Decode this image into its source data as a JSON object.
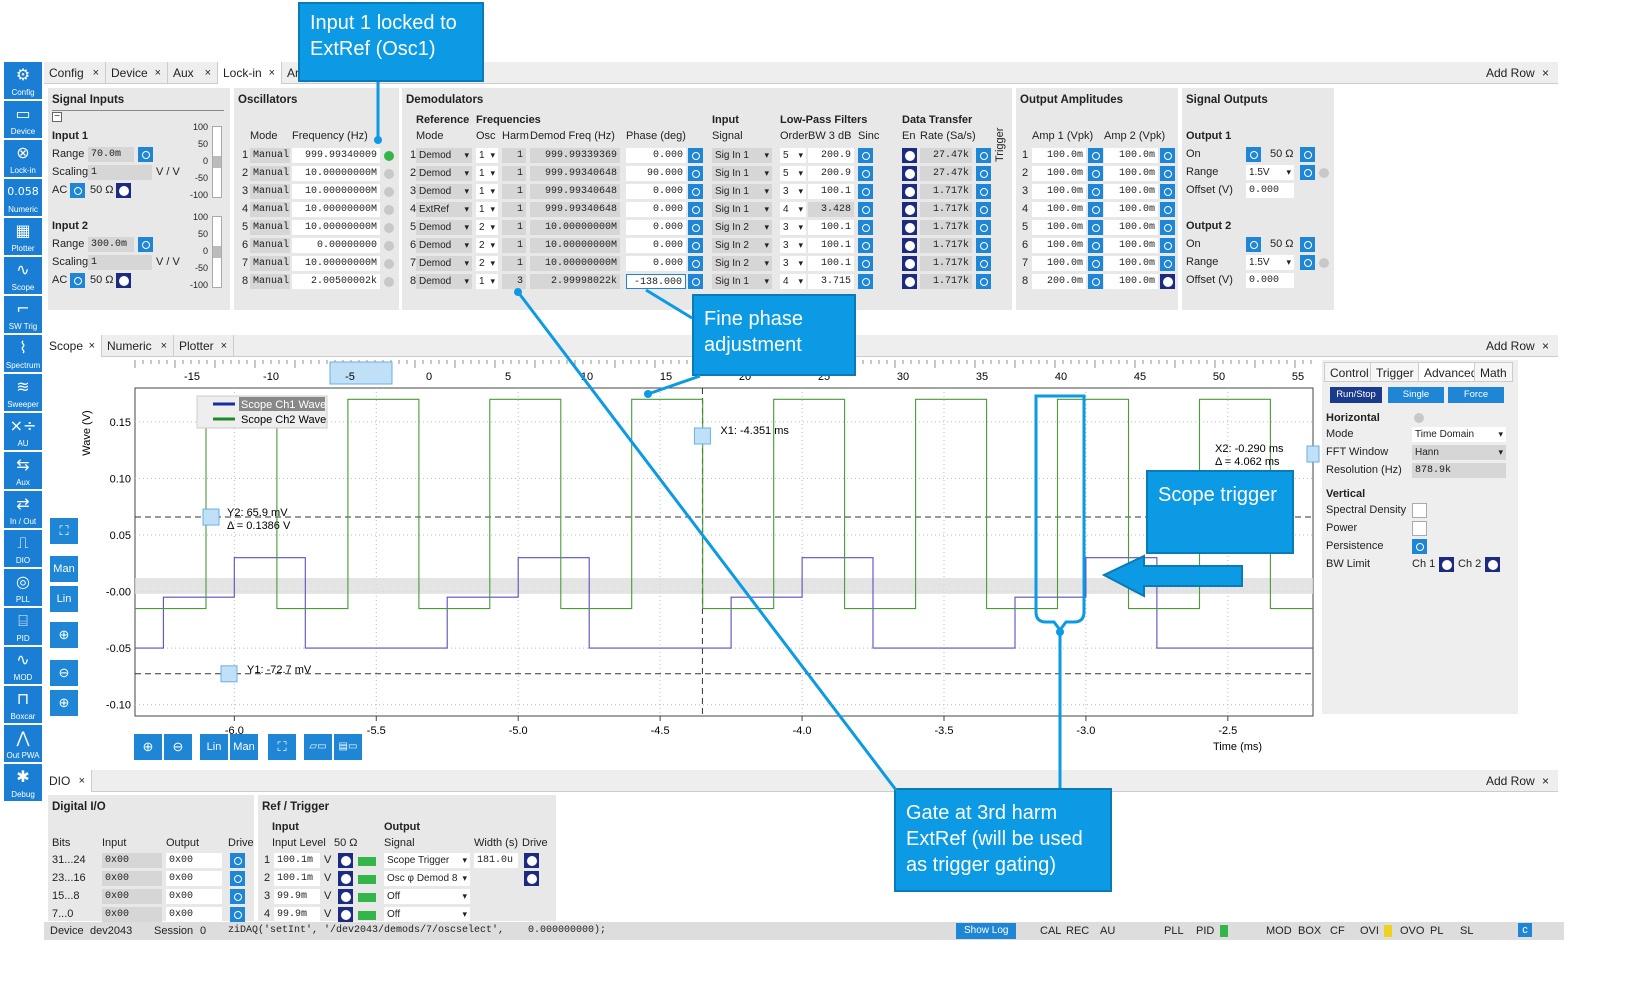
{
  "sidebar": [
    {
      "icon": "⚙",
      "label": "Config"
    },
    {
      "icon": "▭",
      "label": "Device"
    },
    {
      "icon": "⊗",
      "label": "Lock-in"
    },
    {
      "icon": "0.058",
      "label": "Numeric"
    },
    {
      "icon": "▦",
      "label": "Plotter"
    },
    {
      "icon": "∿",
      "label": "Scope"
    },
    {
      "icon": "⌐",
      "label": "SW Trig"
    },
    {
      "icon": "⌇",
      "label": "Spectrum"
    },
    {
      "icon": "≋",
      "label": "Sweeper"
    },
    {
      "icon": "×÷",
      "label": "AU"
    },
    {
      "icon": "⇆",
      "label": "Aux"
    },
    {
      "icon": "⇄",
      "label": "In / Out"
    },
    {
      "icon": "⎍",
      "label": "DIO"
    },
    {
      "icon": "◎",
      "label": "PLL"
    },
    {
      "icon": "⌸",
      "label": "PID"
    },
    {
      "icon": "∿",
      "label": "MOD"
    },
    {
      "icon": "⊓",
      "label": "Boxcar"
    },
    {
      "icon": "⋀",
      "label": "Out PWA"
    },
    {
      "icon": "✱",
      "label": "Debug"
    }
  ],
  "top_tabs": [
    {
      "label": "Config"
    },
    {
      "label": "Device"
    },
    {
      "label": "Aux"
    },
    {
      "label": "Lock-in"
    },
    {
      "label": "Ar"
    }
  ],
  "add_row": "Add Row",
  "close": "×",
  "signal_inputs": {
    "title": "Signal Inputs",
    "input1": {
      "title": "Input 1",
      "range_label": "Range",
      "range": "70.0m",
      "scaling_label": "Scaling",
      "scaling": "1",
      "unit": "V / V",
      "ac": "AC",
      "ohm": "50 Ω"
    },
    "input2": {
      "title": "Input 2",
      "range_label": "Range",
      "range": "300.0m",
      "scaling_label": "Scaling",
      "scaling": "1",
      "unit": "V / V",
      "ac": "AC",
      "ohm": "50 Ω"
    },
    "meter1": [
      "100",
      "50",
      "0",
      "-50",
      "-100"
    ],
    "meter2": [
      "100",
      "50",
      "0",
      "-50",
      "-100"
    ]
  },
  "oscillators": {
    "title": "Oscillators",
    "col_mode": "Mode",
    "col_freq": "Frequency (Hz)",
    "rows": [
      {
        "n": "1",
        "mode": "Manual",
        "freq": "999.99340009"
      },
      {
        "n": "2",
        "mode": "Manual",
        "freq": "10.00000000M"
      },
      {
        "n": "3",
        "mode": "Manual",
        "freq": "10.00000000M"
      },
      {
        "n": "4",
        "mode": "Manual",
        "freq": "10.00000000M"
      },
      {
        "n": "5",
        "mode": "Manual",
        "freq": "10.00000000M"
      },
      {
        "n": "6",
        "mode": "Manual",
        "freq": "0.00000000"
      },
      {
        "n": "7",
        "mode": "Manual",
        "freq": "10.00000000M"
      },
      {
        "n": "8",
        "mode": "Manual",
        "freq": "2.00500002k"
      }
    ]
  },
  "demodulators": {
    "title": "Demodulators",
    "reference": "Reference",
    "frequencies": "Frequencies",
    "input": "Input",
    "lpf": "Low-Pass Filters",
    "dt": "Data Transfer",
    "trigger": "Trigger",
    "col_mode": "Mode",
    "col_osc": "Osc",
    "col_harm": "Harm",
    "col_dfreq": "Demod Freq (Hz)",
    "col_phase": "Phase (deg)",
    "col_signal": "Signal",
    "col_order": "Order",
    "col_bw": "BW 3 dB",
    "col_sinc": "Sinc",
    "col_en": "En",
    "col_rate": "Rate (Sa/s)",
    "rows": [
      {
        "n": "1",
        "mode": "Demod",
        "osc": "1",
        "harm": "1",
        "dfreq": "999.99339369",
        "phase": "0.000",
        "signal": "Sig In 1",
        "order": "5",
        "bw": "200.9",
        "rate": "27.47k"
      },
      {
        "n": "2",
        "mode": "Demod",
        "osc": "1",
        "harm": "1",
        "dfreq": "999.99340648",
        "phase": "90.000",
        "signal": "Sig In 1",
        "order": "5",
        "bw": "200.9",
        "rate": "27.47k"
      },
      {
        "n": "3",
        "mode": "Demod",
        "osc": "1",
        "harm": "1",
        "dfreq": "999.99340648",
        "phase": "0.000",
        "signal": "Sig In 1",
        "order": "3",
        "bw": "100.1",
        "rate": "1.717k"
      },
      {
        "n": "4",
        "mode": "ExtRef",
        "osc": "1",
        "harm": "1",
        "dfreq": "999.99340648",
        "phase": "0.000",
        "signal": "Sig In 1",
        "order": "4",
        "bw": "3.428",
        "rate": "1.717k"
      },
      {
        "n": "5",
        "mode": "Demod",
        "osc": "2",
        "harm": "1",
        "dfreq": "10.00000000M",
        "phase": "0.000",
        "signal": "Sig In 2",
        "order": "3",
        "bw": "100.1",
        "rate": "1.717k"
      },
      {
        "n": "6",
        "mode": "Demod",
        "osc": "2",
        "harm": "1",
        "dfreq": "10.00000000M",
        "phase": "0.000",
        "signal": "Sig In 2",
        "order": "3",
        "bw": "100.1",
        "rate": "1.717k"
      },
      {
        "n": "7",
        "mode": "Demod",
        "osc": "2",
        "harm": "1",
        "dfreq": "10.00000000M",
        "phase": "0.000",
        "signal": "Sig In 2",
        "order": "3",
        "bw": "100.1",
        "rate": "1.717k"
      },
      {
        "n": "8",
        "mode": "Demod",
        "osc": "1",
        "harm": "3",
        "dfreq": "2.99998022k",
        "phase": "-138.000",
        "signal": "Sig In 1",
        "order": "4",
        "bw": "3.715",
        "rate": "1.717k"
      }
    ]
  },
  "output_amplitudes": {
    "title": "Output Amplitudes",
    "col1": "Amp 1 (Vpk)",
    "col2": "Amp 2 (Vpk)",
    "rows": [
      {
        "n": "1",
        "a1": "100.0m",
        "a2": "100.0m"
      },
      {
        "n": "2",
        "a1": "100.0m",
        "a2": "100.0m"
      },
      {
        "n": "3",
        "a1": "100.0m",
        "a2": "100.0m"
      },
      {
        "n": "4",
        "a1": "100.0m",
        "a2": "100.0m"
      },
      {
        "n": "5",
        "a1": "100.0m",
        "a2": "100.0m"
      },
      {
        "n": "6",
        "a1": "100.0m",
        "a2": "100.0m"
      },
      {
        "n": "7",
        "a1": "100.0m",
        "a2": "100.0m"
      },
      {
        "n": "8",
        "a1": "200.0m",
        "a2": "100.0m"
      }
    ]
  },
  "signal_outputs": {
    "title": "Signal Outputs",
    "out1": {
      "title": "Output 1",
      "on": "On",
      "ohm": "50 Ω",
      "range_label": "Range",
      "range": "1.5V",
      "offset_label": "Offset (V)",
      "offset": "0.000"
    },
    "out2": {
      "title": "Output 2",
      "on": "On",
      "ohm": "50 Ω",
      "range_label": "Range",
      "range": "1.5V",
      "offset_label": "Offset (V)",
      "offset": "0.000"
    }
  },
  "mid_tabs": [
    {
      "label": "Scope"
    },
    {
      "label": "Numeric"
    },
    {
      "label": "Plotter"
    }
  ],
  "scope": {
    "ylabel": "Wave (V)",
    "xlabel": "Time (ms)",
    "top_ticks": [
      "-15",
      "-10",
      "-5",
      "0",
      "5",
      "10",
      "15",
      "20",
      "25",
      "30",
      "35",
      "40",
      "45",
      "50",
      "55"
    ],
    "yticks": [
      "0.15",
      "0.10",
      "0.05",
      "-0.00",
      "-0.05",
      "-0.10"
    ],
    "xticks": [
      "-6.0",
      "-5.5",
      "-5.0",
      "-4.5",
      "-4.0",
      "-3.5",
      "-3.0",
      "-2.5"
    ],
    "legend": [
      "Scope Ch1 Wave",
      "Scope Ch2 Wave"
    ],
    "x1": "X1: -4.351 ms",
    "x2": "X2: -0.290 ms",
    "xdelta": "Δ = 4.062 ms",
    "y1": "Y1: -72.7 mV",
    "y2": "Y2: 65.9 mV",
    "ydelta": "Δ = 0.1386 V",
    "side_buttons": [
      "Man",
      "Lin"
    ],
    "bottom_buttons": [
      "Lin",
      "Man"
    ]
  },
  "chart_data": {
    "type": "line",
    "title": "",
    "xlabel": "Time (ms)",
    "ylabel": "Wave (V)",
    "xlim": [
      -6.35,
      -2.2
    ],
    "ylim": [
      -0.11,
      0.18
    ],
    "series": [
      {
        "name": "Scope Ch1 Wave",
        "color": "#5b4fc0",
        "x": [
          -6.35,
          -6.25,
          -6.25,
          -6.0,
          -6.0,
          -5.75,
          -5.75,
          -5.25,
          -5.25,
          -5.0,
          -5.0,
          -4.75,
          -4.75,
          -4.25,
          -4.25,
          -4.0,
          -4.0,
          -3.75,
          -3.75,
          -3.25,
          -3.25,
          -3.0,
          -3.0,
          -2.75,
          -2.75,
          -2.2
        ],
        "y": [
          -0.05,
          -0.05,
          -0.005,
          -0.005,
          0.03,
          0.03,
          -0.05,
          -0.05,
          -0.005,
          -0.005,
          0.03,
          0.03,
          -0.05,
          -0.05,
          -0.005,
          -0.005,
          0.03,
          0.03,
          -0.05,
          -0.05,
          -0.005,
          -0.005,
          0.03,
          0.03,
          -0.05,
          -0.05
        ]
      },
      {
        "name": "Scope Ch2 Wave",
        "color": "#4a9a3a",
        "x": [
          -6.35,
          -6.1,
          -6.1,
          -5.85,
          -5.85,
          -5.6,
          -5.6,
          -5.35,
          -5.35,
          -5.1,
          -5.1,
          -4.85,
          -4.85,
          -4.6,
          -4.6,
          -4.35,
          -4.35,
          -4.1,
          -4.1,
          -3.85,
          -3.85,
          -3.6,
          -3.6,
          -3.35,
          -3.35,
          -3.1,
          -3.1,
          -2.85,
          -2.85,
          -2.6,
          -2.6,
          -2.35,
          -2.35,
          -2.2
        ],
        "y": [
          -0.015,
          -0.015,
          0.17,
          0.17,
          -0.015,
          -0.015,
          0.17,
          0.17,
          -0.015,
          -0.015,
          0.17,
          0.17,
          -0.015,
          -0.015,
          0.17,
          0.17,
          -0.015,
          -0.015,
          0.17,
          0.17,
          -0.015,
          -0.015,
          0.17,
          0.17,
          -0.015,
          -0.015,
          0.17,
          0.17,
          -0.015,
          -0.015,
          0.17,
          0.17,
          -0.015,
          -0.015
        ]
      }
    ]
  },
  "scope_ctrl": {
    "tabs": [
      "Control",
      "Trigger",
      "Advanced",
      "Math"
    ],
    "buttons": [
      "Run/Stop",
      "Single",
      "Force"
    ],
    "horizontal": "Horizontal",
    "mode_label": "Mode",
    "mode": "Time Domain",
    "fft_label": "FFT Window",
    "fft": "Hann",
    "res_label": "Resolution (Hz)",
    "res": "878.9k",
    "vertical": "Vertical",
    "spectral": "Spectral Density",
    "power": "Power",
    "persistence": "Persistence",
    "bwlimit": "BW Limit",
    "ch1": "Ch 1",
    "ch2": "Ch 2"
  },
  "bottom_tab": "DIO",
  "dio": {
    "title": "Digital I/O",
    "col_bits": "Bits",
    "col_input": "Input",
    "col_output": "Output",
    "col_drive": "Drive",
    "rows": [
      {
        "bits": "31...24",
        "in": "0x00",
        "out": "0x00"
      },
      {
        "bits": "23...16",
        "in": "0x00",
        "out": "0x00"
      },
      {
        "bits": "15...8",
        "in": "0x00",
        "out": "0x00"
      },
      {
        "bits": "7...0",
        "in": "0x00",
        "out": "0x00"
      }
    ]
  },
  "reftrig": {
    "title": "Ref / Trigger",
    "input": "Input",
    "output": "Output",
    "col_level": "Input Level",
    "col_ohm": "50 Ω",
    "col_signal": "Signal",
    "col_width": "Width (s)",
    "col_drive": "Drive",
    "rows": [
      {
        "n": "1",
        "level": "100.1m",
        "signal": "Scope Trigger",
        "width": "181.0u"
      },
      {
        "n": "2",
        "level": "100.1m",
        "signal": "Osc φ Demod 8"
      },
      {
        "n": "3",
        "level": "99.9m",
        "signal": "Off"
      },
      {
        "n": "4",
        "level": "99.9m",
        "signal": "Off"
      }
    ],
    "unit": "V"
  },
  "status": {
    "device_label": "Device",
    "device": "dev2043",
    "session_label": "Session",
    "session": "0",
    "cmd": "ziDAQ('setInt', '/dev2043/demods/7/oscselect',    0.000000000);",
    "showlog": "Show Log",
    "flags": [
      "CAL",
      "REC",
      "AU",
      "PLL",
      "PID",
      "MOD",
      "BOX",
      "CF",
      "OVI",
      "OVO",
      "PL",
      "SL"
    ],
    "c": "c"
  },
  "callouts": {
    "c1": "Input 1 locked to ExtRef (Osc1)",
    "c2": "Fine phase adjustment",
    "c3": "Scope trigger",
    "c4": "Gate at 3rd harm ExtRef (will be used as trigger gating)"
  }
}
